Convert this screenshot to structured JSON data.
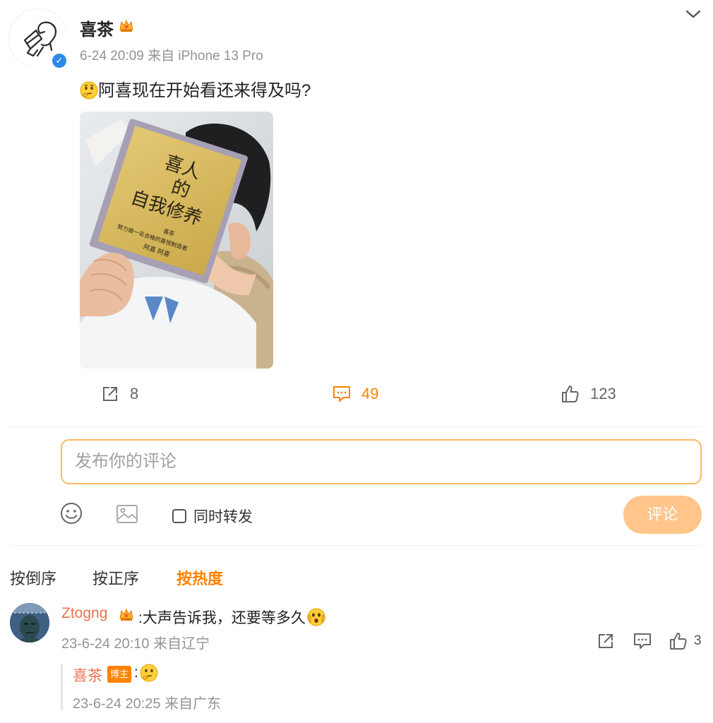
{
  "post": {
    "author": "喜茶",
    "meta": "6-24 20:09 来自 iPhone 13 Pro",
    "text": "阿喜现在开始看还来得及吗?",
    "photo": {
      "book_title_lines": [
        "喜人",
        "的",
        "自我修养"
      ],
      "book_subtitle": "努力做一名合格的喜悦制造者",
      "book_author_prefix": "喜茶",
      "book_publisher": "阿喜 阿喜"
    }
  },
  "actions": {
    "repost_count": "8",
    "comment_count": "49",
    "like_count": "123"
  },
  "composer": {
    "placeholder": "发布你的评论",
    "forward_label": "同时转发",
    "submit_label": "评论"
  },
  "sort": {
    "reverse": "按倒序",
    "forward": "按正序",
    "hot": "按热度"
  },
  "comment": {
    "author": "Ztogng",
    "text": ":大声告诉我，还要等多久",
    "meta": "23-6-24 20:10 来自辽宁",
    "like_count": "3"
  },
  "reply": {
    "author": "喜茶",
    "badge": "博主",
    "text": ":",
    "meta": "23-6-24 20:25 来自广东"
  },
  "colors": {
    "accent": "#ff8200",
    "name": "#eb7350",
    "verified": "#2d8ae8",
    "muted": "#939393"
  }
}
